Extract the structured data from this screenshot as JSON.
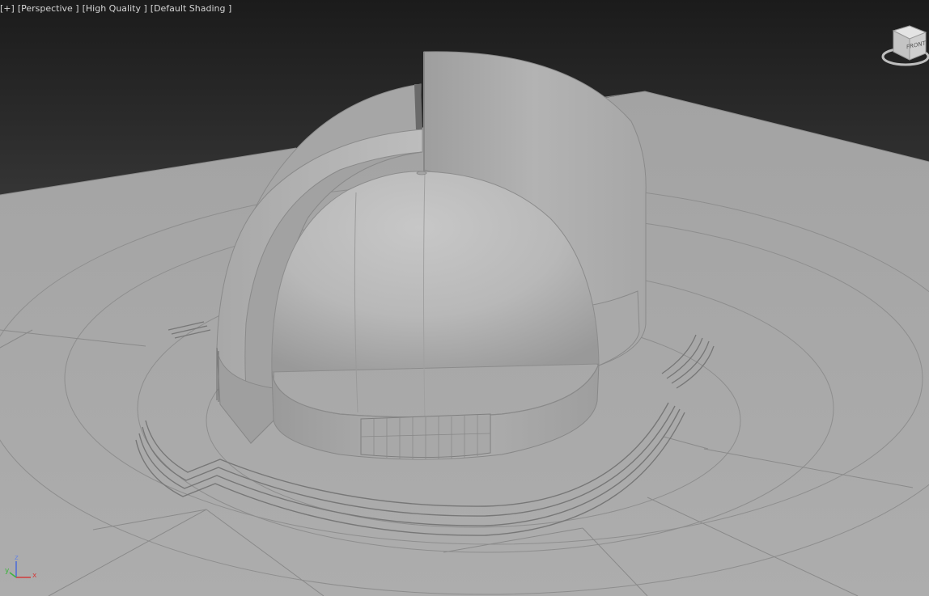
{
  "viewport": {
    "labels": {
      "menu": "[+]",
      "view": "[Perspective ]",
      "quality": "[High Quality ]",
      "shading": "[Default Shading ]"
    },
    "viewcube": {
      "face_label": "FRONT"
    },
    "axis_gizmo": {
      "x_label": "x",
      "y_label": "y",
      "z_label": "z"
    }
  },
  "colors": {
    "background_top": "#1b1b1b",
    "background_bottom": "#3e3e3e",
    "ground": "#a9a9a9",
    "model": "#b4b4b4",
    "label_text": "#d4d4d4",
    "axis_x": "#d23c3c",
    "axis_y": "#3cb43c",
    "axis_z": "#4a6bd8"
  }
}
